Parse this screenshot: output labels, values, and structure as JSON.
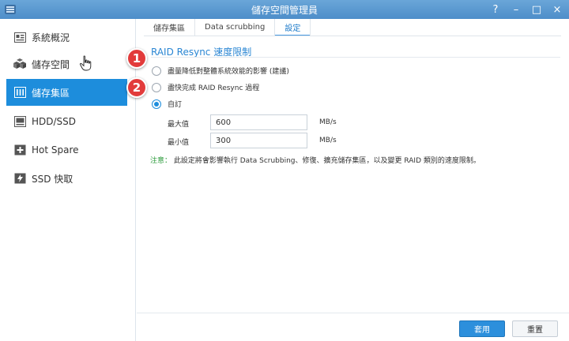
{
  "window": {
    "title": "儲存空間管理員",
    "controls": {
      "help": "?",
      "minimize": "–",
      "maximize": "□",
      "close": "×"
    }
  },
  "sidebar": {
    "items": [
      {
        "label": "系統概況",
        "icon": "overview-icon"
      },
      {
        "label": "儲存空間",
        "icon": "volume-icon"
      },
      {
        "label": "儲存集區",
        "icon": "storage-pool-icon",
        "active": true
      },
      {
        "label": "HDD/SSD",
        "icon": "disk-icon"
      },
      {
        "label": "Hot Spare",
        "icon": "hot-spare-icon"
      },
      {
        "label": "SSD 快取",
        "icon": "ssd-cache-icon"
      }
    ]
  },
  "tabs": [
    {
      "label": "儲存集區"
    },
    {
      "label": "Data scrubbing"
    },
    {
      "label": "設定",
      "active": true
    }
  ],
  "settings": {
    "section_title": "RAID Resync 速度限制",
    "options": [
      {
        "label": "盡量降低對整體系統效能的影響 (建議)",
        "checked": false
      },
      {
        "label": "盡快完成 RAID Resync 過程",
        "checked": false
      },
      {
        "label": "自訂",
        "checked": true
      }
    ],
    "max_label": "最大值",
    "max_value": "600",
    "min_label": "最小值",
    "min_value": "300",
    "unit": "MB/s",
    "note_keyword": "注意：",
    "note_text": "此設定將會影響執行 Data Scrubbing、修復、擴充儲存集區，以及變更 RAID 類別的速度限制。"
  },
  "annotations": {
    "badge1": "1",
    "badge2": "2"
  },
  "footer": {
    "apply_label": "套用",
    "reset_label": "重置"
  },
  "colors": {
    "accent": "#1d8ddc",
    "badge": "#e23b3b",
    "note": "#2a9a3a"
  }
}
